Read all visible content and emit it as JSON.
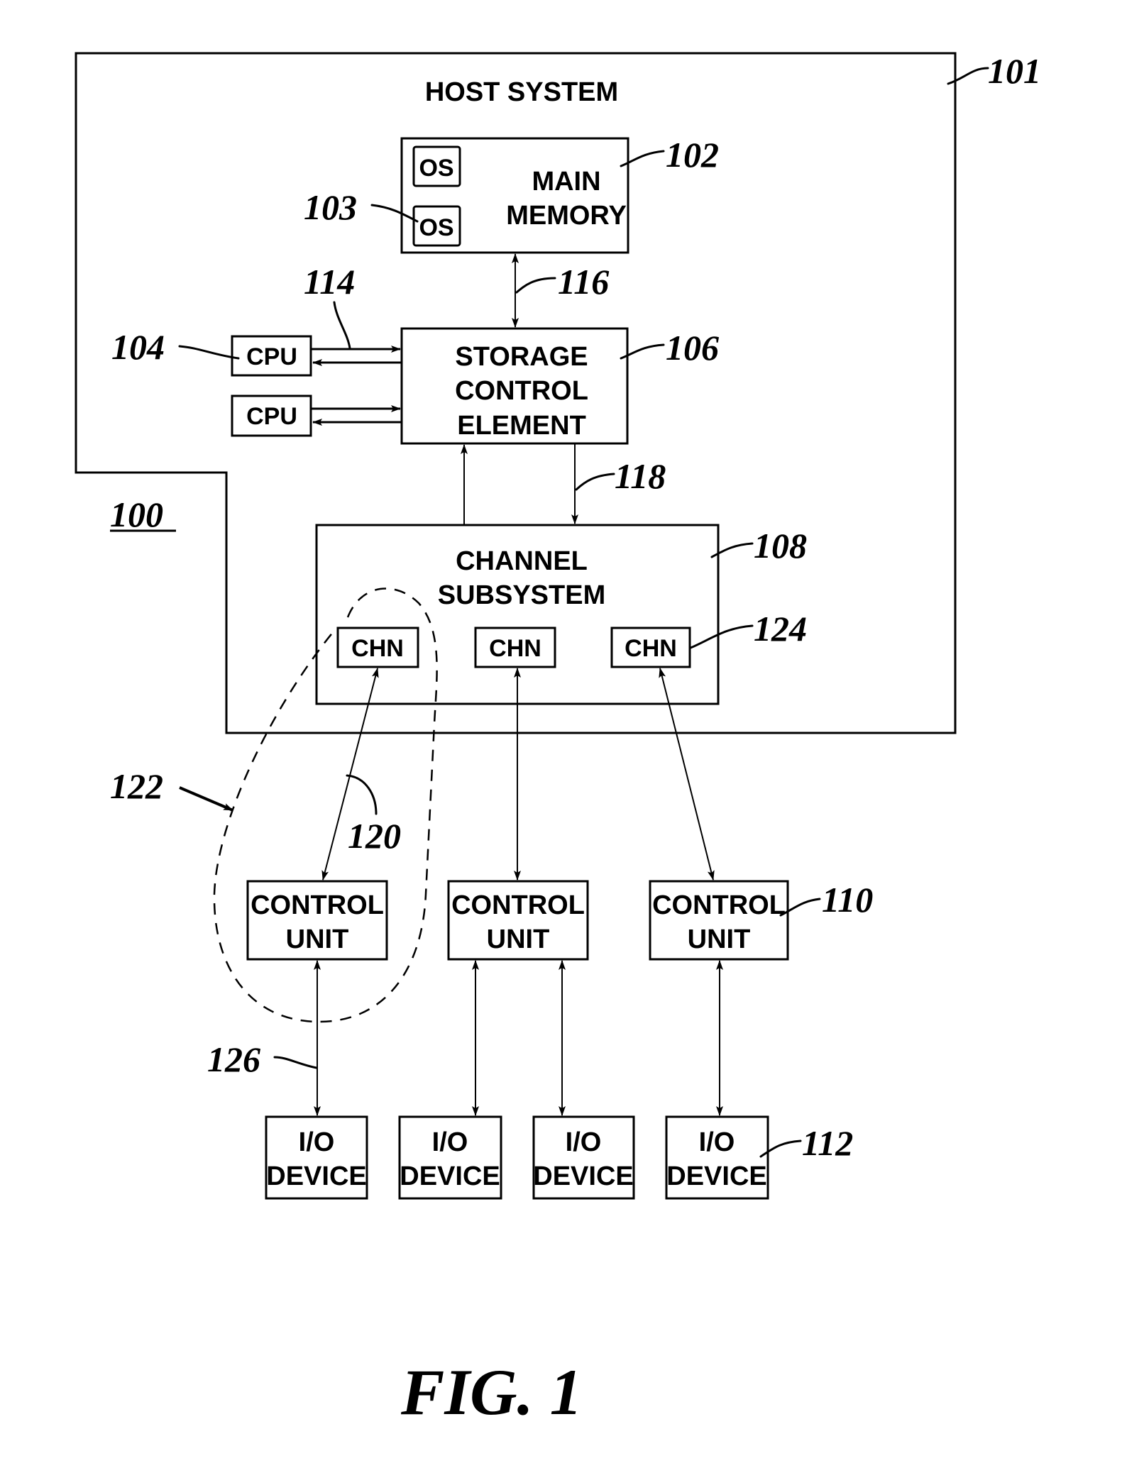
{
  "figure": {
    "caption": "FIG. 1",
    "system_ref": "100"
  },
  "host": {
    "title": "HOST SYSTEM",
    "ref": "101"
  },
  "main_memory": {
    "line1": "MAIN",
    "line2": "MEMORY",
    "ref": "102",
    "os_label": "OS",
    "os_ref": "103"
  },
  "cpus": {
    "label": "CPU",
    "ref": "104",
    "bus_ref": "114"
  },
  "storage_control": {
    "line1": "STORAGE",
    "line2": "CONTROL",
    "line3": "ELEMENT",
    "ref": "106",
    "memory_bus_ref": "116",
    "channel_bus_ref": "118"
  },
  "channel_subsystem": {
    "line1": "CHANNEL",
    "line2": "SUBSYSTEM",
    "ref": "108",
    "channel_label": "CHN",
    "channel_ref": "124"
  },
  "control_units": {
    "line1": "CONTROL",
    "line2": "UNIT",
    "ref": "110",
    "link_ref": "120",
    "path_ref": "122"
  },
  "io_devices": {
    "line1": "I/O",
    "line2": "DEVICE",
    "ref": "112",
    "link_ref": "126"
  }
}
